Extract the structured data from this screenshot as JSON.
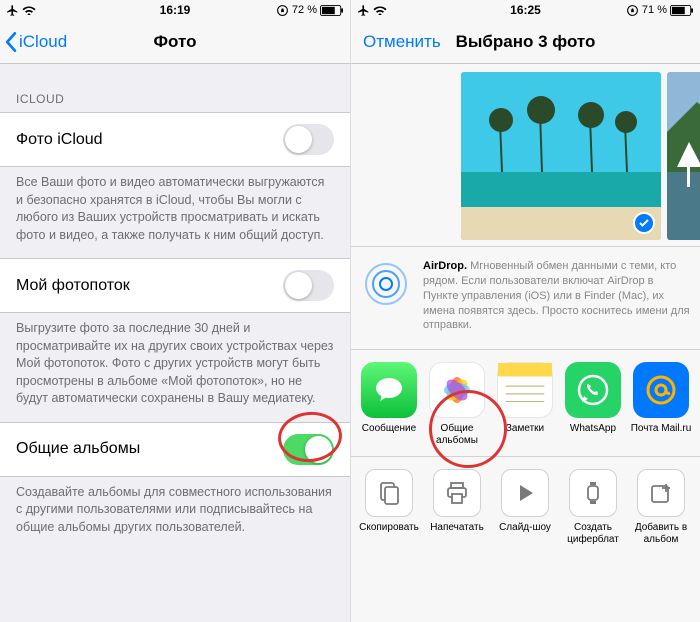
{
  "left": {
    "status": {
      "time": "16:19",
      "battery": "72 %"
    },
    "nav": {
      "back": "iCloud",
      "title": "Фото"
    },
    "group1_header": "ICLOUD",
    "row1_label": "Фото iCloud",
    "row1_footer": "Все Ваши фото и видео автоматически выгружаются и безопасно хранятся в iCloud, чтобы Вы могли с любого из Ваших устройств просматривать и искать фото и видео, а также получать к ним общий доступ.",
    "row2_label": "Мой фотопоток",
    "row2_footer": "Выгрузите фото за последние 30 дней и просматривайте их на других своих устройствах через Мой фотопоток. Фото с других устройств могут быть просмотрены в альбоме «Мой фотопоток», но не будут автоматически сохранены в Вашу медиатеку.",
    "row3_label": "Общие альбомы",
    "row3_footer": "Создавайте альбомы для совместного использования с другими пользователями или подписывайтесь на общие альбомы других пользователей."
  },
  "right": {
    "status": {
      "time": "16:25",
      "battery": "71 %"
    },
    "nav": {
      "cancel": "Отменить",
      "title": "Выбрано 3 фото"
    },
    "airdrop": {
      "bold": "AirDrop.",
      "text": "Мгновенный обмен данными с теми, кто рядом. Если пользователи включат AirDrop в Пункте управления (iOS) или в Finder (Mac), их имена появятся здесь. Просто коснитесь имени для отправки."
    },
    "apps": [
      {
        "name": "messages",
        "label": "Сообщение",
        "color": "#35d54a"
      },
      {
        "name": "shared-albums",
        "label": "Общие альбомы",
        "color": "#fff"
      },
      {
        "name": "notes",
        "label": "Заметки",
        "color": "#fff"
      },
      {
        "name": "whatsapp",
        "label": "WhatsApp",
        "color": "#25d366"
      },
      {
        "name": "mailru",
        "label": "Почта Mail.ru",
        "color": "#0078ff"
      }
    ],
    "actions": [
      {
        "name": "copy",
        "label": "Скопировать"
      },
      {
        "name": "print",
        "label": "Напечатать"
      },
      {
        "name": "slideshow",
        "label": "Слайд-шоу"
      },
      {
        "name": "watchface",
        "label": "Создать циферблат"
      },
      {
        "name": "add-to-album",
        "label": "Добавить в альбом"
      }
    ]
  }
}
